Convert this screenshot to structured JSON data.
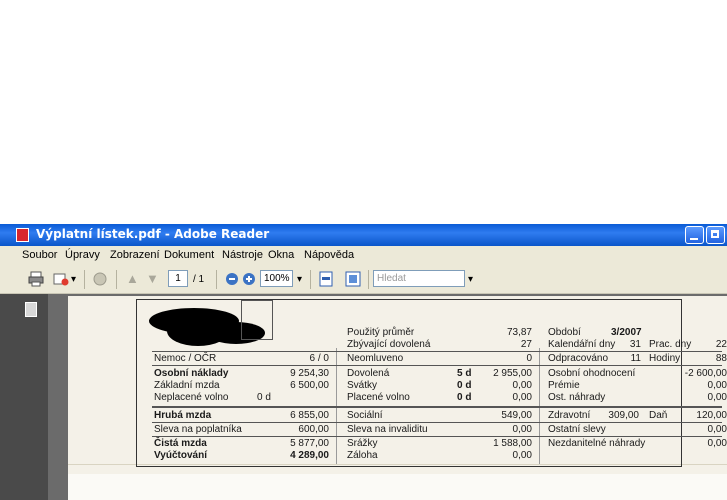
{
  "window": {
    "title": "Výplatní lístek.pdf - Adobe Reader"
  },
  "menu": [
    "Soubor",
    "Úpravy",
    "Zobrazení",
    "Dokument",
    "Nástroje",
    "Okna",
    "Nápověda"
  ],
  "toolbar": {
    "page_number": "1",
    "page_total": "/ 1",
    "zoom": "100%",
    "search_placeholder": "Hledat"
  },
  "slip": {
    "top": {
      "used_avg_label": "Použitý průměr",
      "used_avg_value": "73,87",
      "remaining_leave_label": "Zbývající dovolená",
      "remaining_leave_value": "27",
      "period_label": "Období",
      "period_value": "3/2007",
      "calendar_days_label": "Kalendářní dny",
      "calendar_days_value": "31",
      "work_days_label": "Prac. dny",
      "work_days_value": "22"
    },
    "row1": {
      "sick_label": "Nemoc / OČR",
      "sick_value": "6 / 0",
      "unexcused_label": "Neomluveno",
      "unexcused_value": "0",
      "worked_label": "Odpracováno",
      "worked_days": "11",
      "hours_label": "Hodiny",
      "hours_value": "88"
    },
    "block2": {
      "personal_costs_label": "Osobní náklady",
      "personal_costs_value": "9 254,30",
      "base_wage_label": "Základní mzda",
      "base_wage_value": "6 500,00",
      "unpaid_leave_label": "Neplacené volno",
      "unpaid_leave_days": "0 d",
      "vacation_label": "Dovolená",
      "vacation_days": "5 d",
      "vacation_value": "2 955,00",
      "holidays_label": "Svátky",
      "holidays_days": "0 d",
      "holidays_value": "0,00",
      "paid_leave_label": "Placené volno",
      "paid_leave_days": "0 d",
      "paid_leave_value": "0,00",
      "personal_eval_label": "Osobní ohodnocení",
      "personal_eval_value": "-2 600,00",
      "bonus_label": "Prémie",
      "bonus_value": "0,00",
      "other_comp_label": "Ost. náhrady",
      "other_comp_value": "0,00"
    },
    "row3": {
      "gross_label": "Hrubá mzda",
      "gross_value": "6 855,00",
      "social_label": "Sociální",
      "social_value": "549,00",
      "health_label": "Zdravotní",
      "health_value": "309,00",
      "tax_label": "Daň",
      "tax_value": "120,00"
    },
    "row4": {
      "taxpayer_discount_label": "Sleva na poplatníka",
      "taxpayer_discount_value": "600,00",
      "disability_discount_label": "Sleva na invaliditu",
      "disability_discount_value": "0,00",
      "other_discounts_label": "Ostatní slevy",
      "other_discounts_value": "0,00"
    },
    "row5": {
      "net_label": "Čistá mzda",
      "net_value": "5 877,00",
      "deductions_label": "Srážky",
      "deductions_value": "1 588,00",
      "nontaxable_label": "Nezdanitelné náhrady",
      "nontaxable_value": "0,00",
      "settlement_label": "Vyúčtování",
      "settlement_value": "4 289,00",
      "advance_label": "Záloha",
      "advance_value": "0,00"
    }
  }
}
